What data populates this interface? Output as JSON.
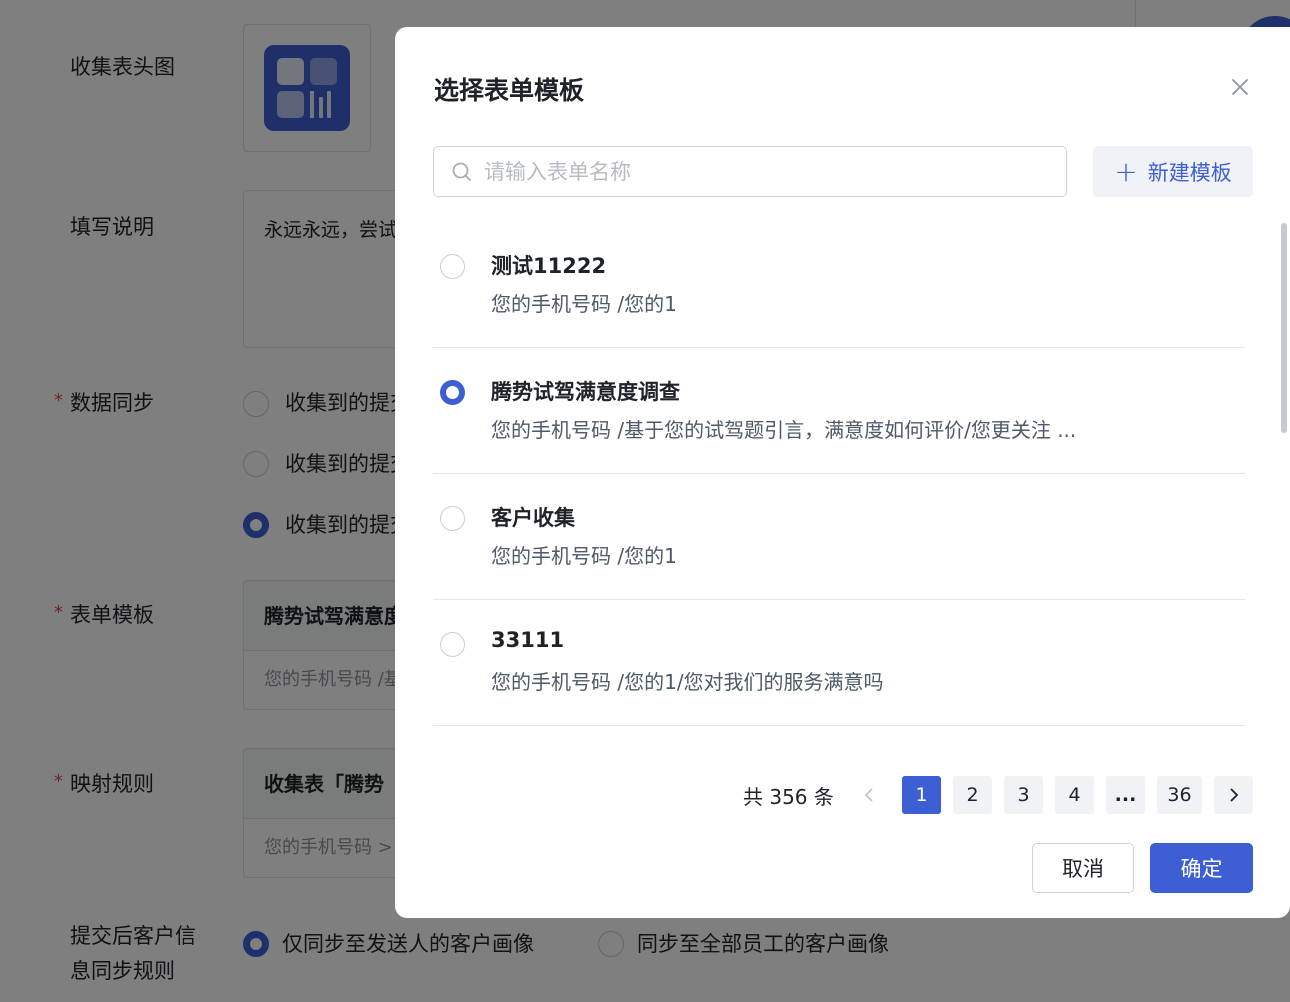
{
  "background": {
    "labels": {
      "header_image": "收集表头图",
      "instructions": "填写说明",
      "data_sync": "数据同步",
      "form_template": "表单模板",
      "mapping_rule": "映射规则",
      "post_submit_rule_line1": "提交后客户信",
      "post_submit_rule_line2": "息同步规则"
    },
    "required_mark": "*",
    "instructions_text": "永远永远，尝试",
    "sync_options": [
      "收集到的提交",
      "收集到的提交",
      "收集到的提交"
    ],
    "template_card": {
      "title": "腾势试驾满意度",
      "subtitle": "您的手机号码 /基"
    },
    "mapping_card": {
      "title": "收集表「腾势",
      "subtitle": "您的手机号码 >"
    },
    "post_submit_options": [
      "仅同步至发送人的客户画像",
      "同步至全部员工的客户画像"
    ]
  },
  "modal": {
    "title": "选择表单模板",
    "search_placeholder": "请输入表单名称",
    "search_value": "",
    "new_template_label": "新建模板",
    "items": [
      {
        "name": "测试11222",
        "desc": "您的手机号码 /您的1",
        "selected": false
      },
      {
        "name": "腾势试驾满意度调查",
        "desc": "您的手机号码 /基于您的试驾题引言，满意度如何评价/您更关注 ...",
        "selected": true
      },
      {
        "name": "客户收集",
        "desc": "您的手机号码 /您的1",
        "selected": false
      },
      {
        "name": "33111",
        "desc": "您的手机号码 /您的1/您对我们的服务满意吗",
        "selected": false
      }
    ],
    "pagination": {
      "total_text": "共 356 条",
      "pages": [
        "1",
        "2",
        "3",
        "4",
        "...",
        "36"
      ],
      "current": "1"
    },
    "cancel_label": "取消",
    "ok_label": "确定"
  },
  "colors": {
    "accent": "#3d5fd3",
    "overlay": "rgba(0,0,0,0.5)"
  },
  "icons": [
    "close-icon",
    "search-icon",
    "plus-icon",
    "chevron-left-icon",
    "chevron-right-icon"
  ]
}
